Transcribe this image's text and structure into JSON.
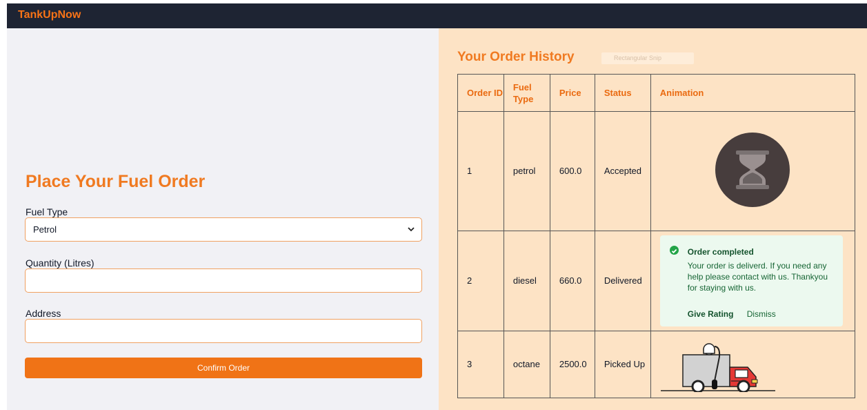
{
  "navbar": {
    "brand": "TankUpNow"
  },
  "order_form": {
    "title": "Place Your Fuel Order",
    "fuel_type_label": "Fuel Type",
    "fuel_type_value": "Petrol",
    "quantity_label": "Quantity (Litres)",
    "quantity_value": "",
    "address_label": "Address",
    "address_value": "",
    "submit_label": "Confirm Order"
  },
  "history": {
    "title": "Your Order History",
    "ghost_chip": "Rectangular Snip",
    "columns": [
      "Order ID",
      "Fuel Type",
      "Price",
      "Status",
      "Animation"
    ],
    "rows": [
      {
        "id": "1",
        "fuel": "petrol",
        "price": "600.0",
        "status": "Accepted",
        "animation": "hourglass-icon"
      },
      {
        "id": "2",
        "fuel": "diesel",
        "price": "660.0",
        "status": "Delivered",
        "animation": "order-completed-toast"
      },
      {
        "id": "3",
        "fuel": "octane",
        "price": "2500.0",
        "status": "Picked Up",
        "animation": "delivery-truck-icon"
      }
    ]
  },
  "toast": {
    "title": "Order completed",
    "body": "Your order is deliverd. If you need any help please contact with us. Thankyou for staying with us.",
    "rate_label": "Give Rating",
    "dismiss_label": "Dismiss"
  },
  "colors": {
    "accent": "#f07316",
    "navbar": "#1e2433",
    "history_bg": "#fde3c5",
    "success": "#22a447"
  }
}
